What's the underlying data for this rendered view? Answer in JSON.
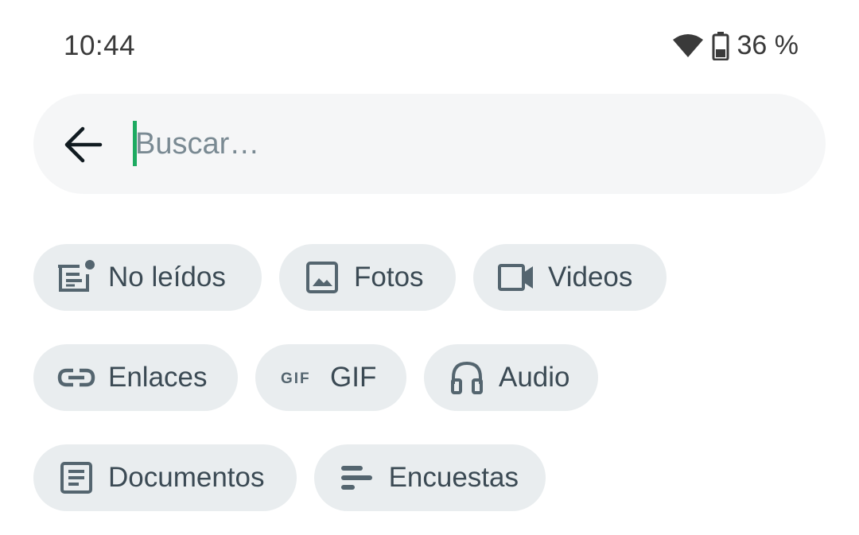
{
  "status_bar": {
    "time": "10:44",
    "battery": "36 %",
    "icons": [
      "wifi-icon",
      "battery-icon"
    ]
  },
  "search": {
    "placeholder": "Buscar…",
    "value": "",
    "back_icon": "arrow-left-icon"
  },
  "filters": {
    "unread": {
      "label": "No leídos",
      "icon": "unread-icon"
    },
    "photos": {
      "label": "Fotos",
      "icon": "image-icon"
    },
    "videos": {
      "label": "Videos",
      "icon": "video-icon"
    },
    "links": {
      "label": "Enlaces",
      "icon": "link-icon"
    },
    "gif": {
      "label": "GIF",
      "icon": "gif-icon"
    },
    "audio": {
      "label": "Audio",
      "icon": "headphones-icon"
    },
    "documents": {
      "label": "Documentos",
      "icon": "document-icon"
    },
    "polls": {
      "label": "Encuestas",
      "icon": "poll-icon"
    }
  },
  "colors": {
    "accent": "#1daa61",
    "chip_bg": "#e9edef",
    "search_bg": "#f5f6f7",
    "text": "#3b4a54",
    "icon": "#54656f"
  }
}
